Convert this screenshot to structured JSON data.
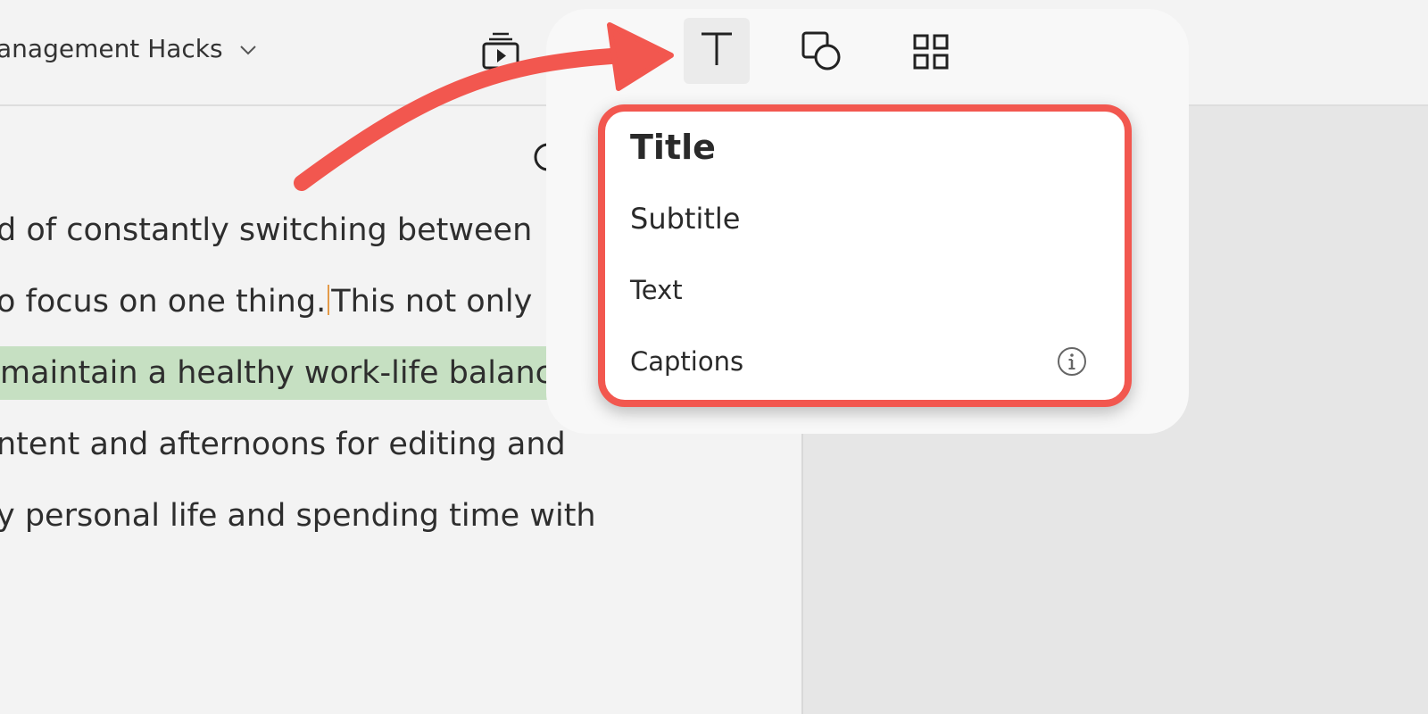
{
  "header": {
    "project_title": "anagement Hacks",
    "icons": [
      "chevron-down-icon",
      "preview-icon",
      "record-icon",
      "text-icon",
      "shapes-icon",
      "grid-icon"
    ]
  },
  "editor": {
    "lines": [
      "d of constantly switching between",
      "o focus on one thing.",
      "This not only",
      "maintain a healthy work-life balance",
      "ntent and afternoons for editing and",
      "y personal life and spending time with"
    ],
    "search_icon": "search-icon"
  },
  "menu": {
    "items": [
      "Title",
      "Subtitle",
      "Text",
      "Captions"
    ],
    "captions_icon": "info-icon"
  },
  "colors": {
    "annotation": "#f2574f",
    "highlight": "#c6e0c2",
    "active_tool_bg": "#ebebeb"
  }
}
